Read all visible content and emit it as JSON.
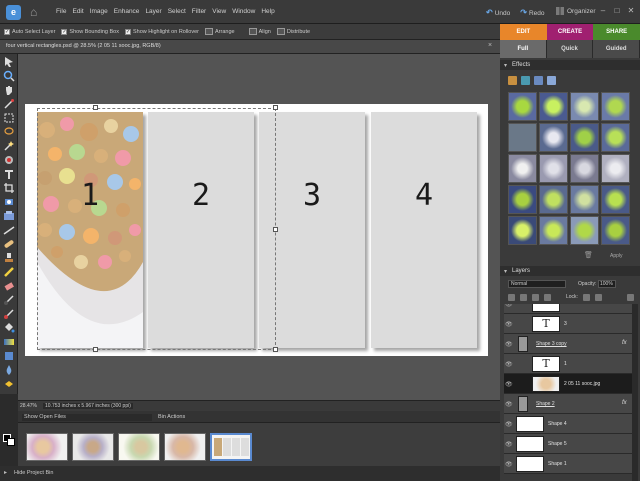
{
  "menubar": {
    "logo": "e",
    "menus": [
      "File",
      "Edit",
      "Image",
      "Enhance",
      "Layer",
      "Select",
      "Filter",
      "View",
      "Window",
      "Help"
    ],
    "undo": "Undo",
    "redo": "Redo",
    "organizer": "Organizer"
  },
  "options": {
    "auto_select": "Auto Select Layer",
    "show_bounding": "Show Bounding Box",
    "show_highlight": "Show Highlight on Rollover",
    "arrange": "Arrange",
    "align": "Align",
    "distribute": "Distribute"
  },
  "mode_tabs": [
    "EDIT",
    "CREATE",
    "SHARE"
  ],
  "document": {
    "title": "four vertical rectangles.psd @ 28.5% (2 05 11 sooc.jpg, RGB/8)",
    "panels": [
      "1",
      "2",
      "3",
      "4"
    ]
  },
  "status": {
    "zoom": "28.47%",
    "dimensions": "10.753 inches x 5.967 inches (300 ppi)"
  },
  "bin": {
    "show": "Show Open Files",
    "actions": "Bin Actions",
    "hide": "Hide Project Bin"
  },
  "right_panel": {
    "modes": [
      "Full",
      "Quick",
      "Guided"
    ],
    "effects_title": "Effects",
    "apply": "Apply",
    "layers_title": "Layers",
    "blend_mode": "Normal",
    "opacity_label": "Opacity:",
    "opacity_value": "100%",
    "lock_label": "Lock:",
    "layers": [
      {
        "name": "",
        "type": "blank"
      },
      {
        "name": "3",
        "type": "text"
      },
      {
        "name": "Shape 3 copy",
        "type": "shape",
        "fx": "fx"
      },
      {
        "name": "1",
        "type": "text"
      },
      {
        "name": "2 05 11 sooc.jpg",
        "type": "image",
        "selected": true
      },
      {
        "name": "Shape 2",
        "type": "shape",
        "fx": "fx"
      },
      {
        "name": "Shape 4",
        "type": "white"
      },
      {
        "name": "Shape 5",
        "type": "white"
      },
      {
        "name": "Shape 1",
        "type": "white"
      }
    ]
  },
  "colors": {
    "edit": "#e8862a",
    "create": "#a02070",
    "share": "#4a8a2c",
    "accent": "#4a90d8"
  }
}
